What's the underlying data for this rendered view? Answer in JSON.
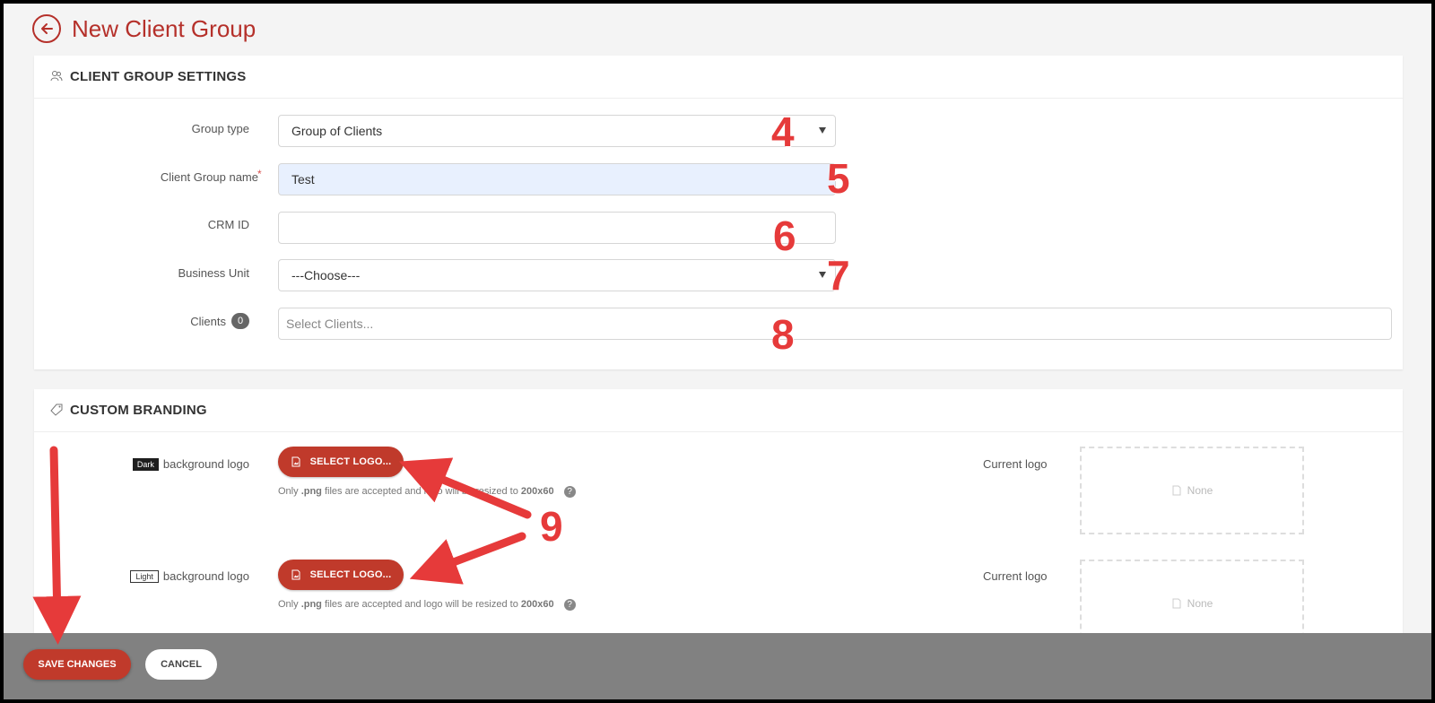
{
  "header": {
    "title": "New Client Group",
    "back_icon": "arrow-left-circle-icon"
  },
  "settings": {
    "section_title": "CLIENT GROUP SETTINGS",
    "section_icon": "users-icon",
    "fields": {
      "group_type": {
        "label": "Group type",
        "value": "Group of Clients"
      },
      "group_name": {
        "label": "Client Group name",
        "required": "*",
        "value": "Test"
      },
      "crm_id": {
        "label": "CRM ID",
        "value": ""
      },
      "business_unit": {
        "label": "Business Unit",
        "value": "---Choose---"
      },
      "clients": {
        "label": "Clients",
        "count": "0",
        "placeholder": "Select Clients..."
      }
    }
  },
  "branding": {
    "section_title": "CUSTOM BRANDING",
    "section_icon": "tag-icon",
    "dark": {
      "tag": "Dark",
      "label": "background logo",
      "button": "SELECT LOGO...",
      "hint_prefix": "Only",
      "hint_ext": ".png",
      "hint_mid": "files are accepted and logo will be resized to",
      "hint_size": "200x60",
      "current_label": "Current logo",
      "current_value": "None"
    },
    "light": {
      "tag": "Light",
      "label": "background logo",
      "button": "SELECT LOGO...",
      "hint_prefix": "Only",
      "hint_ext": ".png",
      "hint_mid": "files are accepted and logo will be resized to",
      "hint_size": "200x60",
      "current_label": "Current logo",
      "current_value": "None"
    }
  },
  "footer": {
    "save": "SAVE CHANGES",
    "cancel": "CANCEL"
  },
  "annotations": {
    "a4": "4",
    "a5": "5",
    "a6": "6",
    "a7": "7",
    "a8": "8",
    "a9": "9"
  },
  "colors": {
    "accent": "#c03a2b",
    "annotation": "#e63a3a",
    "footer": "#818181"
  }
}
